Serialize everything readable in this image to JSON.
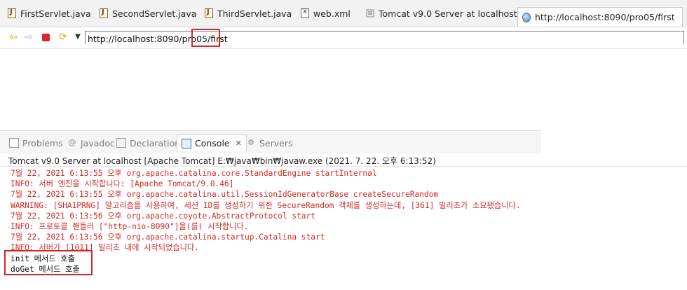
{
  "editor_tabs": [
    {
      "label": "FirstServlet.java",
      "icon": "java-file-icon"
    },
    {
      "label": "SecondServlet.java",
      "icon": "java-file-icon"
    },
    {
      "label": "ThirdServlet.java",
      "icon": "java-file-icon"
    },
    {
      "label": "web.xml",
      "icon": "xml-file-icon"
    },
    {
      "label": "Tomcat v9.0 Server at localhost",
      "icon": "server-editor-icon"
    },
    {
      "label": "http://localhost:8090/pro05/first",
      "icon": "globe-icon",
      "active": true
    }
  ],
  "browser": {
    "url": "http://localhost:8090/pro05/first",
    "buttons": [
      "back-icon",
      "forward-icon",
      "stop-icon",
      "refresh-icon",
      "dropdown-icon"
    ]
  },
  "view_tabs": [
    {
      "label": "Problems",
      "icon": "problems-icon"
    },
    {
      "label": "Javadoc",
      "icon": "javadoc-icon"
    },
    {
      "label": "Declaration",
      "icon": "declaration-icon"
    },
    {
      "label": "Console",
      "icon": "console-icon",
      "active": true,
      "close": "✕"
    },
    {
      "label": "Servers",
      "icon": "servers-icon"
    }
  ],
  "console": {
    "header": "Tomcat v9.0 Server at localhost [Apache Tomcat] E:₩java₩bin₩javaw.exe (2021. 7. 22. 오후 6:13:52)",
    "lines": [
      "7월 22, 2021 6:13:55 오후 org.apache.catalina.core.StandardEngine startInternal",
      "INFO: 서버 엔진을 시작합니다: [Apache Tomcat/9.0.46]",
      "7월 22, 2021 6:13:55 오후 org.apache.catalina.util.SessionIdGeneratorBase createSecureRandom",
      "WARNING: [SHA1PRNG] 알고리즘을 사용하여, 세션 ID를 생성하기 위한 SecureRandom 객체를 생성하는데, [361] 밀리초가 소요됐습니다.",
      "7월 22, 2021 6:13:56 오후 org.apache.coyote.AbstractProtocol start",
      "INFO: 프로토콜 핸들러 [\"http-nio-8090\"]을(를) 시작합니다.",
      "7월 22, 2021 6:13:56 오후 org.apache.catalina.startup.Catalina start",
      "INFO: 서버가 [1011] 밀리초 내에 시작되었습니다.",
      "init 메서드 호출",
      "doGet 메서드 호출"
    ]
  },
  "colors": {
    "stderr": "#d22a26",
    "stdout": "#111111",
    "highlight": "#d8232a"
  }
}
